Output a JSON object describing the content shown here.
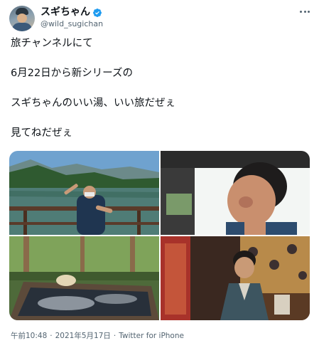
{
  "author": {
    "display_name": "スギちゃん",
    "handle": "@wild_sugichan",
    "verified": true
  },
  "tweet": {
    "lines": [
      "旅チャンネルにて",
      "6月22日から新シリーズの",
      "スギちゃんのいい湯、いい旅だぜぇ",
      "見てねだぜぇ"
    ]
  },
  "media": {
    "count": 4
  },
  "meta": {
    "time": "午前10:48",
    "date": "2021年5月17日",
    "source": "Twitter for iPhone",
    "separator": "·"
  },
  "colors": {
    "text": "#0f1419",
    "secondary": "#536471",
    "verified": "#1d9bf0"
  },
  "icons": [
    "verified-badge-icon",
    "more-options-icon"
  ]
}
